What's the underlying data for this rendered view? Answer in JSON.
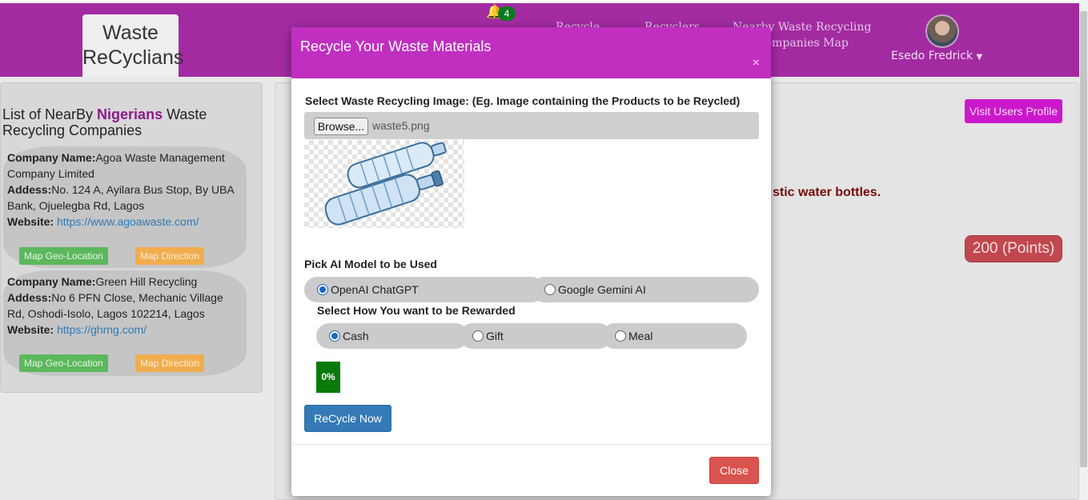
{
  "header": {
    "logo_line1": "Waste",
    "logo_line2": "ReCyclians",
    "notification_count": "4",
    "nav": [
      "Recycle",
      "Recyclers",
      "Nearby Waste Recycling",
      "Companies Map"
    ],
    "user_name": "Esedo Fredrick"
  },
  "sidebar": {
    "title_prefix": "List of NearBy ",
    "title_highlight": "Nigerians",
    "title_suffix": " Waste Recycling Companies",
    "companies": [
      {
        "name_label": "Company Name:",
        "name": "Agoa Waste Management Company Limited",
        "address_label": "Addess:",
        "address": "No. 124 A, Ayilara Bus Stop, By UBA Bank, Ojuelegba Rd, Lagos",
        "website_label": "Website:",
        "website": "https://www.agoawaste.com/",
        "geo_button": "Map Geo-Location",
        "direction_button": "Map Direction"
      },
      {
        "name_label": "Company Name:",
        "name": "Green Hill Recycling",
        "address_label": "Addess:",
        "address": "No 6 PFN Close, Mechanic Village Rd, Oshodi-Isolo, Lagos 102214, Lagos",
        "website_label": "Website:",
        "website": "https://ghrng.com/",
        "geo_button": "Map Geo-Location",
        "direction_button": "Map Direction"
      }
    ]
  },
  "main": {
    "visit_profile_button": "Visit Users Profile",
    "partial_text": "stic water bottles.",
    "points": "200 (Points)"
  },
  "modal": {
    "title": "Recycle Your Waste Materials",
    "close_x": "×",
    "image_label": "Select Waste Recycling Image: (Eg. Image containing the Products to be Reycled)",
    "browse_button": "Browse...",
    "file_name": "waste5.png",
    "model_label": "Pick AI Model to be Used",
    "models": [
      {
        "label": "OpenAI ChatGPT",
        "selected": true
      },
      {
        "label": "Google Gemini AI",
        "selected": false
      }
    ],
    "reward_label": "Select How You want to be Rewarded",
    "rewards": [
      {
        "label": "Cash",
        "selected": true
      },
      {
        "label": "Gift",
        "selected": false
      },
      {
        "label": "Meal",
        "selected": false
      }
    ],
    "progress_percent": 0,
    "progress_text": "0%",
    "recycle_button": "ReCycle Now",
    "close_button": "Close"
  },
  "colors": {
    "navbar": "#a22ba2",
    "modal_header": "#c02fc0",
    "primary": "#337ab7",
    "danger": "#d9534f",
    "progress": "#0a7a0a"
  }
}
